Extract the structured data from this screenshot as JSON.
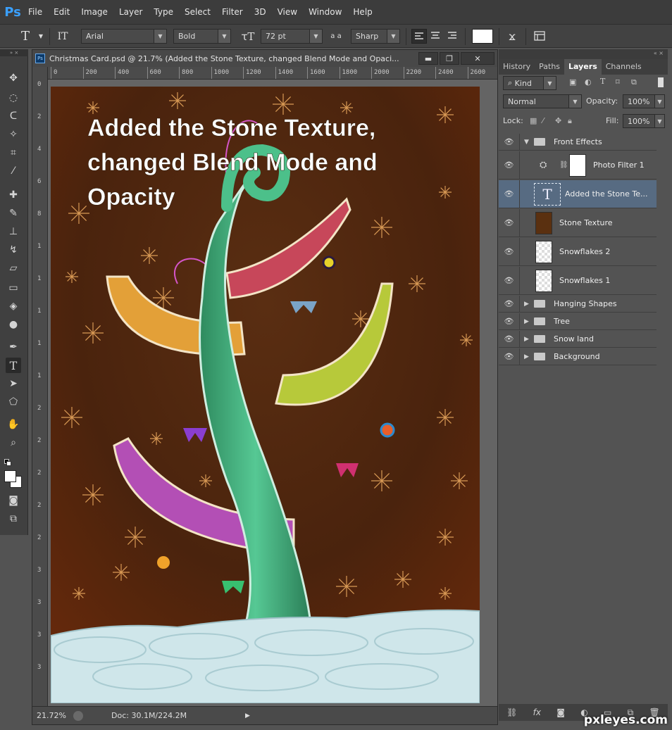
{
  "app": {
    "logo": "Ps"
  },
  "menu": [
    "File",
    "Edit",
    "Image",
    "Layer",
    "Type",
    "Select",
    "Filter",
    "3D",
    "View",
    "Window",
    "Help"
  ],
  "options": {
    "font_family": "Arial",
    "font_style": "Bold",
    "font_size": "72 pt",
    "aa_label": "a a",
    "anti_alias": "Sharp",
    "color_swatch": "#ffffff"
  },
  "document": {
    "title": "Christmas Card.psd @ 21.7% (Added the Stone Texture, changed Blend Mode and Opaci...",
    "btn_minimize": "▬",
    "btn_maximize": "❐",
    "btn_close": "✕",
    "ruler_h": [
      "0",
      "200",
      "400",
      "600",
      "800",
      "1000",
      "1200",
      "1400",
      "1600",
      "1800",
      "2000",
      "2200",
      "2400",
      "2600"
    ],
    "ruler_v": [
      "0",
      "2",
      "4",
      "6",
      "8",
      "1",
      "1",
      "1",
      "1",
      "1",
      "2",
      "2",
      "2",
      "2",
      "2",
      "3",
      "3",
      "3",
      "3"
    ],
    "canvas_text_lines": [
      "Added the Stone Texture,",
      "changed Blend Mode and",
      "Opacity"
    ],
    "zoom": "21.72%",
    "doc_info": "Doc: 30.1M/224.2M"
  },
  "layers_panel": {
    "tabs": [
      "History",
      "Paths",
      "Layers",
      "Channels"
    ],
    "active_tab": "Layers",
    "filter_kind": "Kind",
    "blend_mode": "Normal",
    "opacity_label": "Opacity:",
    "opacity_value": "100%",
    "lock_label": "Lock:",
    "fill_label": "Fill:",
    "fill_value": "100%",
    "layers": [
      {
        "name": "Front Effects",
        "kind": "group-open"
      },
      {
        "name": "Photo Filter 1",
        "kind": "adjustment"
      },
      {
        "name": "Added the Stone Te...",
        "kind": "text",
        "selected": true
      },
      {
        "name": "Stone Texture",
        "kind": "image"
      },
      {
        "name": "Snowflakes 2",
        "kind": "transparent"
      },
      {
        "name": "Snowflakes 1",
        "kind": "transparent"
      },
      {
        "name": "Hanging Shapes",
        "kind": "group"
      },
      {
        "name": "Tree",
        "kind": "group"
      },
      {
        "name": "Snow land",
        "kind": "group"
      },
      {
        "name": "Background",
        "kind": "group"
      }
    ],
    "footer_icons": [
      "link-icon",
      "fx-icon",
      "mask-icon",
      "adjustment-icon",
      "folder-icon",
      "new-layer-icon",
      "trash-icon"
    ]
  },
  "watermark": "pxleyes.com",
  "colors": {
    "canvas_bg": "#4a2410",
    "text_on_canvas": "#ffffff",
    "selected_layer": "#576b82",
    "tree_green": "#3fb07a",
    "snow": "#cfe6ea"
  }
}
